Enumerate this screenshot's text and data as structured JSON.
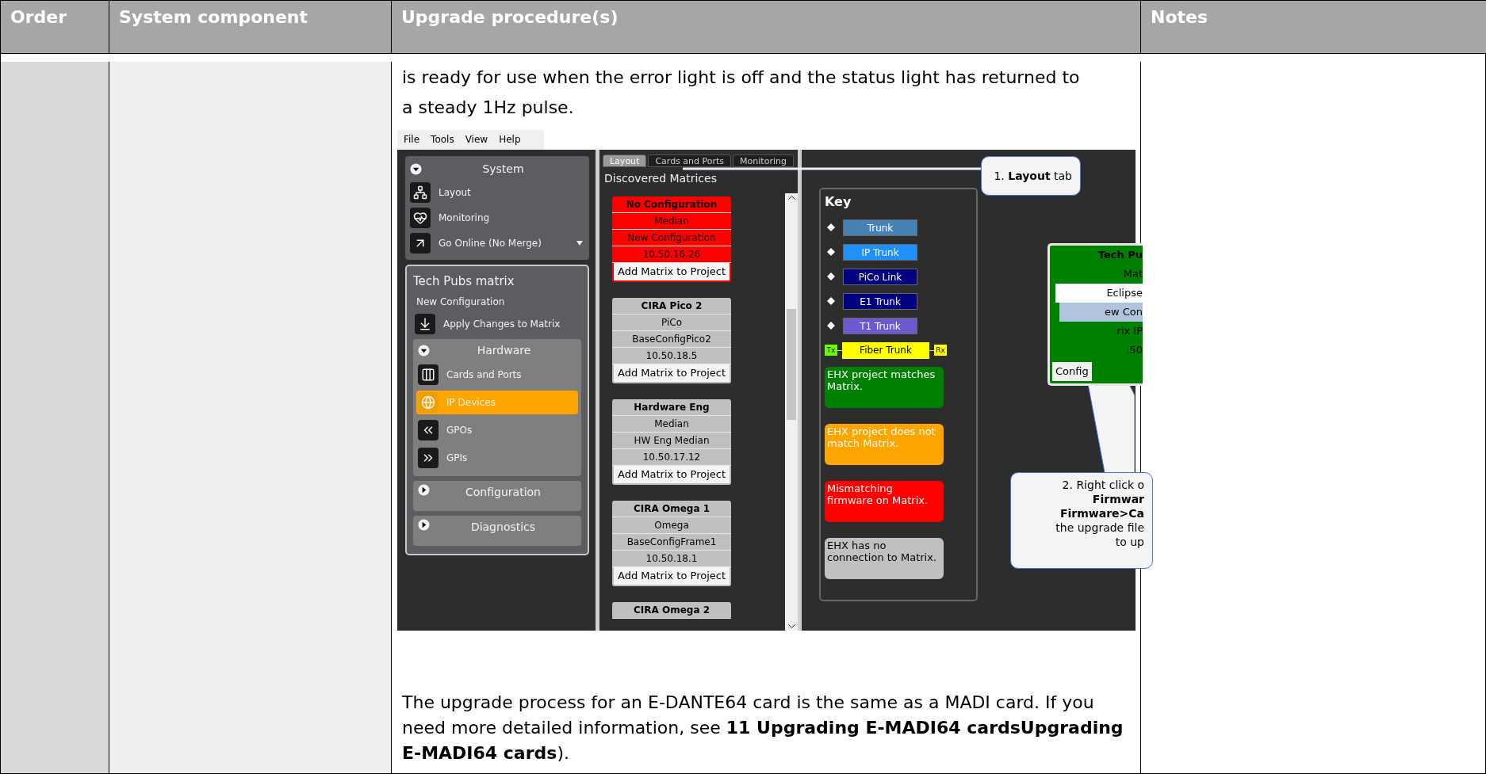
{
  "table": {
    "columns": [
      "Order",
      "System component",
      "Upgrade procedure(s)",
      "Notes"
    ],
    "intro": "is ready for use when the error light is off and the status light has returned to a steady 1Hz pulse.",
    "outro": "The upgrade process for an E-DANTE64 card is the same as a MADI card. If you need more detailed information, see **11 Upgrading E-MADI64 cardsUpgrading E-MADI64 cards**)."
  },
  "screenshot": {
    "menu": [
      "File",
      "Tools",
      "View",
      "Help"
    ],
    "system": {
      "title": "System",
      "expanded": true,
      "items": [
        {
          "label": "Layout",
          "kind": "layout"
        },
        {
          "label": "Monitoring",
          "kind": "monitoring"
        },
        {
          "label": "Go Online (No Merge)",
          "kind": "online"
        }
      ]
    },
    "matrix": {
      "title": "Tech Pubs matrix",
      "subtitle": "New Configuration",
      "action": "Apply Changes to Matrix",
      "hardware": {
        "title": "Hardware",
        "expanded": true,
        "items": [
          {
            "label": "Cards and Ports",
            "kind": "cards",
            "selected": false
          },
          {
            "label": "IP Devices",
            "kind": "ip",
            "selected": true
          },
          {
            "label": "GPOs",
            "kind": "gpo",
            "selected": false
          },
          {
            "label": "GPIs",
            "kind": "gpi",
            "selected": false
          }
        ]
      },
      "sections": [
        {
          "title": "Configuration",
          "expanded": false
        },
        {
          "title": "Diagnostics",
          "expanded": false
        }
      ]
    },
    "tabs": [
      {
        "label": "Layout",
        "selected": true
      },
      {
        "label": "Cards and Ports",
        "selected": false
      },
      {
        "label": "Monitoring",
        "selected": false
      }
    ],
    "discovered": {
      "title": "Discovered Matrices",
      "matrices": [
        {
          "color": "#ff0000",
          "lines": [
            "No Configuration",
            "Median",
            "New Configuration",
            "10.50.16.26"
          ],
          "button": "Add Matrix to Project"
        },
        {
          "color": "#c0c0c0",
          "lines": [
            "CIRA Pico 2",
            "PiCo",
            "BaseConfigPico2",
            "10.50.18.5"
          ],
          "button": "Add Matrix to Project"
        },
        {
          "color": "#c0c0c0",
          "lines": [
            "Hardware Eng",
            "Median",
            "HW Eng Median",
            "10.50.17.12"
          ],
          "button": "Add Matrix to Project"
        },
        {
          "color": "#c0c0c0",
          "lines": [
            "CIRA Omega 1",
            "Omega",
            "BaseConfigFrame1",
            "10.50.18.1"
          ],
          "button": "Add Matrix to Project"
        },
        {
          "color": "#c0c0c0",
          "lines": [
            "CIRA Omega 2"
          ]
        }
      ]
    },
    "key": {
      "title": "Key",
      "links": [
        {
          "label": "Trunk",
          "color": "#4682b4"
        },
        {
          "label": "IP Trunk",
          "color": "#1e90ff"
        },
        {
          "label": "PiCo Link",
          "color": "#000080"
        },
        {
          "label": "E1 Trunk",
          "color": "#000080"
        },
        {
          "label": "T1 Trunk",
          "color": "#6a5acd"
        }
      ],
      "fiber": {
        "label": "Fiber Trunk",
        "tx": "Tx",
        "rx": "Rx"
      },
      "states": [
        {
          "text": "EHX project matches Matrix.",
          "color": "#008000"
        },
        {
          "text": "EHX project does not match Matrix.",
          "color": "#ffa500"
        },
        {
          "text": "Mismatching firmware on Matrix.",
          "color": "#ff0000"
        },
        {
          "text": "EHX has no connection to Matrix.",
          "color": "#c0c0c0"
        }
      ]
    },
    "partial_card": {
      "title": "Tech Pu",
      "lines": [
        "Mat",
        "Eclipse",
        "ew Con",
        "rix IP",
        ".50"
      ],
      "button": "Config"
    },
    "callouts": [
      {
        "lines": [
          "1. **Layout** tab"
        ]
      },
      {
        "lines": [
          "2. Right click o",
          "**Firmwar**",
          "**Firmware>Ca**",
          "the upgrade file",
          "to up"
        ]
      }
    ]
  }
}
